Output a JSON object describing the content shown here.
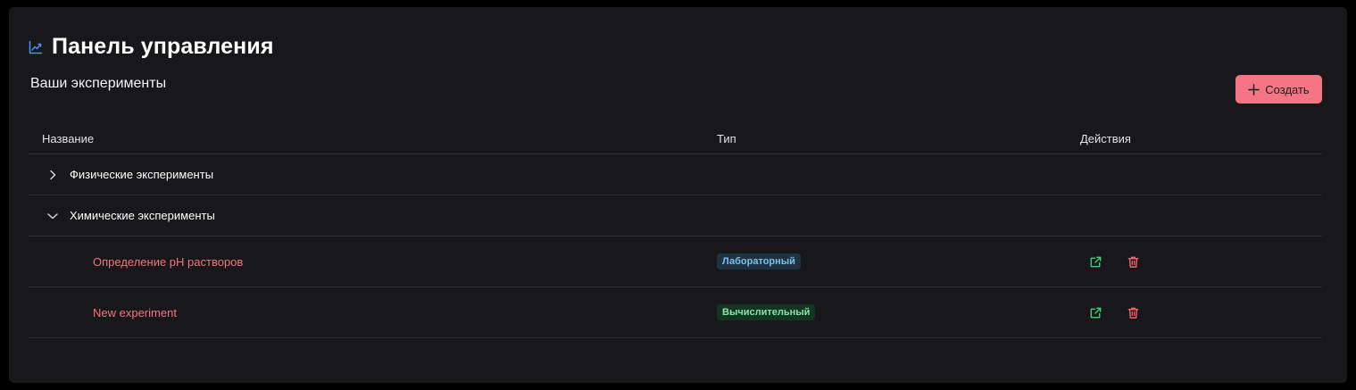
{
  "header": {
    "title": "Панель управления",
    "title_icon": "chart-line-icon",
    "subtitle": "Ваши эксперименты"
  },
  "toolbar": {
    "create_label": "Создать",
    "create_icon": "plus-icon",
    "accent_color": "#f57584"
  },
  "table": {
    "columns": [
      "Название",
      "Тип",
      "Действия"
    ],
    "groups": [
      {
        "label": "Физические эксперименты",
        "expanded": false,
        "icon": "chevron-right-icon",
        "items": []
      },
      {
        "label": "Химические эксперименты",
        "expanded": true,
        "icon": "chevron-down-icon",
        "items": [
          {
            "name": "Определение pH растворов",
            "type": "Лабораторный",
            "actions": [
              "external-link-icon",
              "trash-icon"
            ]
          },
          {
            "name": "New experiment",
            "type": "Вычислительный",
            "actions": [
              "external-link-icon",
              "trash-icon"
            ]
          }
        ]
      }
    ]
  },
  "colors": {
    "item_name": "#f07582",
    "badge_lab_text": "#7cc0ea",
    "badge_comp_text": "#86e3a6",
    "open_icon": "#3ecf78",
    "delete_icon": "#f0606c"
  }
}
